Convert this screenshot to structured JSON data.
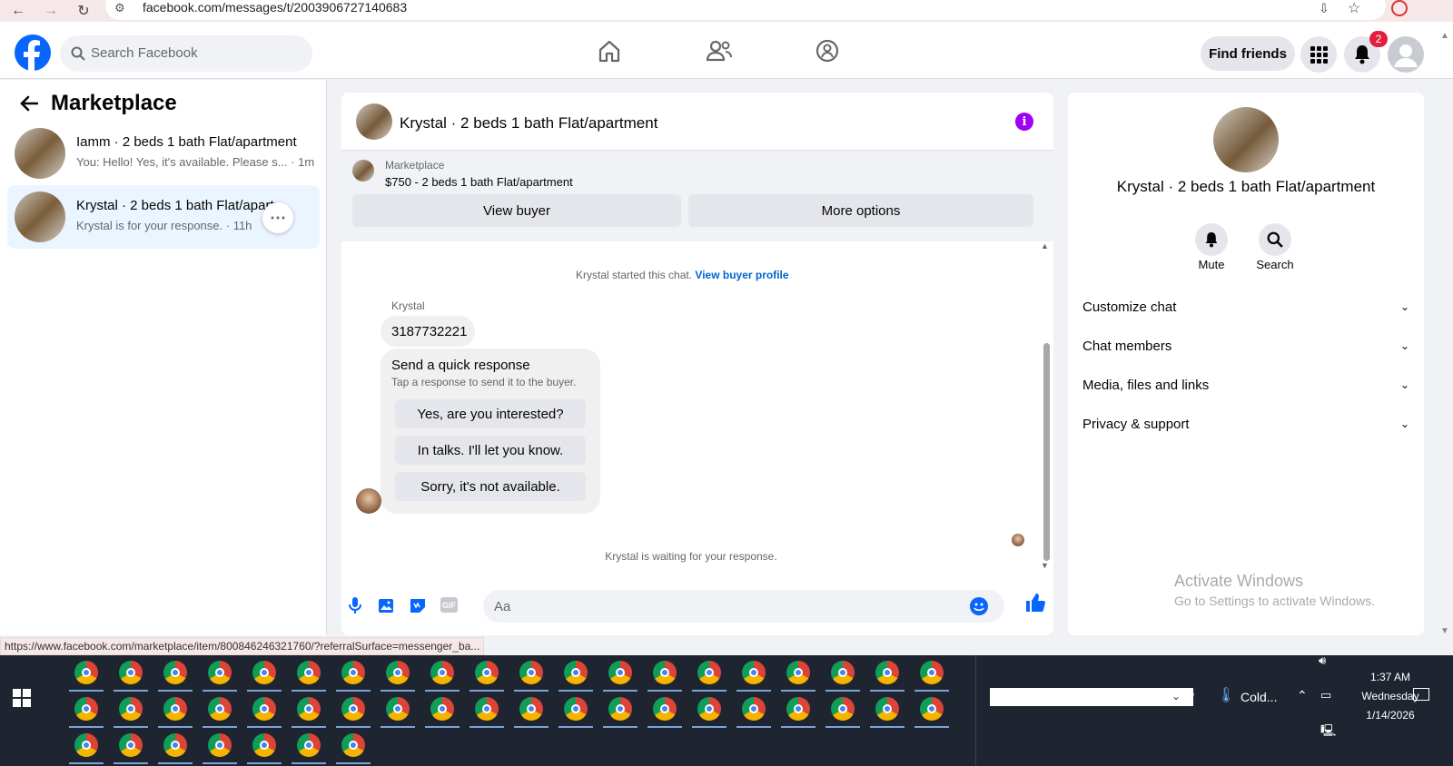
{
  "browser": {
    "url": "facebook.com/messages/t/2003906727140683",
    "status_url": "https://www.facebook.com/marketplace/item/800846246321760/?referralSurface=messenger_ba..."
  },
  "header": {
    "search_placeholder": "Search Facebook",
    "find_friends": "Find friends",
    "notif_count": "2",
    "brand_color": "#0866ff"
  },
  "left": {
    "title": "Marketplace",
    "conversations": [
      {
        "name": "Iamm · 2 beds 1 bath Flat/apartment",
        "snippet": "You: Hello! Yes, it's available. Please s...",
        "time": "1m"
      },
      {
        "name": "Krystal · 2 beds 1 bath Flat/apartment",
        "snippet": "Krystal is for your response.",
        "time": "11h"
      }
    ]
  },
  "chat": {
    "title": "Krystal · 2 beds 1 bath Flat/apartment",
    "listing_label": "Marketplace",
    "listing_text": "$750 - 2 beds 1 bath Flat/apartment",
    "view_buyer": "View buyer",
    "more_options": "More options",
    "started_text": "Krystal started this chat.",
    "view_profile": "View buyer profile",
    "sender": "Krystal",
    "message": "3187732221",
    "quick_title": "Send a quick response",
    "quick_sub": "Tap a response to send it to the buyer.",
    "quick_options": [
      "Yes, are you interested?",
      "In talks. I'll let you know.",
      "Sorry, it's not available."
    ],
    "waiting": "Krystal is waiting for your response.",
    "input_placeholder": "Aa"
  },
  "right": {
    "title": "Krystal · 2 beds 1 bath Flat/apartment",
    "mute": "Mute",
    "search": "Search",
    "rows": [
      "Customize chat",
      "Chat members",
      "Media, files and links",
      "Privacy & support"
    ],
    "watermark1": "Activate Windows",
    "watermark2": "Go to Settings to activate Windows."
  },
  "taskbar": {
    "weather": "Cold...",
    "time": "1:37 AM",
    "day": "Wednesday",
    "date": "1/14/2026"
  }
}
